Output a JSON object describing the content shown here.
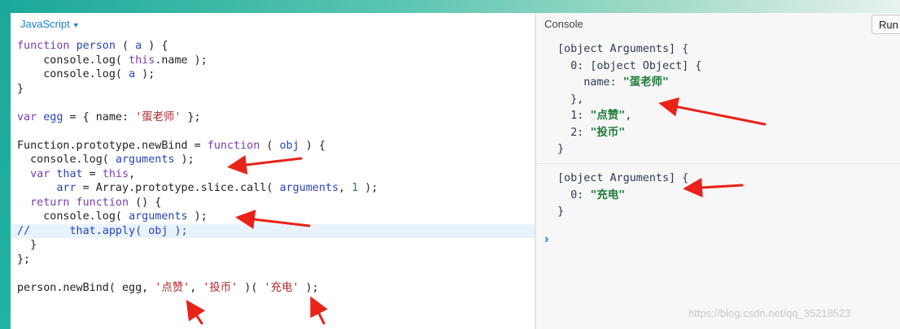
{
  "editor": {
    "language": "JavaScript",
    "code": {
      "l1_a": "function ",
      "l1_b": "person",
      "l1_c": " ( ",
      "l1_d": "a",
      "l1_e": " ) {",
      "l2_a": "    console.log( ",
      "l2_b": "this",
      "l2_c": ".name );",
      "l3_a": "    console.log( ",
      "l3_b": "a",
      "l3_c": " );",
      "l4": "}",
      "l6_a": "var ",
      "l6_b": "egg",
      "l6_c": " = { name: ",
      "l6_d": "'蛋老师'",
      "l6_e": " };",
      "l8_a": "Function.prototype.newBind = ",
      "l8_b": "function",
      "l8_c": " ( ",
      "l8_d": "obj",
      "l8_e": " ) {",
      "l9_a": "  console.log( ",
      "l9_b": "arguments",
      "l9_c": " );",
      "l10_a": "  ",
      "l10_b": "var ",
      "l10_c": "that",
      "l10_d": " = ",
      "l10_e": "this",
      "l10_f": ",",
      "l11_a": "      ",
      "l11_b": "arr",
      "l11_c": " = Array.prototype.slice.call( ",
      "l11_d": "arguments",
      "l11_e": ", ",
      "l11_f": "1",
      "l11_g": " );",
      "l12_a": "  ",
      "l12_b": "return function",
      "l12_c": " () {",
      "l13_a": "    console.log( ",
      "l13_b": "arguments",
      "l13_c": " );",
      "l14": "//      that.apply( obj );",
      "l15": "  }",
      "l16": "};",
      "l18_a": "person.newBind( egg, ",
      "l18_b": "'点赞'",
      "l18_c": ", ",
      "l18_d": "'投币'",
      "l18_e": " )( ",
      "l18_f": "'充电'",
      "l18_g": " );"
    }
  },
  "console": {
    "title": "Console",
    "run_label": "Run",
    "entry1": {
      "l1": "[object Arguments] {",
      "l2": "  0: [object Object] {",
      "l3_key": "    name: ",
      "l3_val": "\"蛋老师\"",
      "l4": "  },",
      "l5_key": "  1: ",
      "l5_val": "\"点赞\"",
      "l5_end": ",",
      "l6_key": "  2: ",
      "l6_val": "\"投币\"",
      "l7": "}"
    },
    "entry2": {
      "l1": "[object Arguments] {",
      "l2_key": "  0: ",
      "l2_val": "\"充电\"",
      "l3": "}"
    },
    "prompt": "›"
  },
  "watermark": "https://blog.csdn.net/qq_35218523",
  "colors": {
    "accent": "#1aa89a",
    "annotation_arrow": "#e8231a",
    "link_blue": "#1a7fd4"
  }
}
